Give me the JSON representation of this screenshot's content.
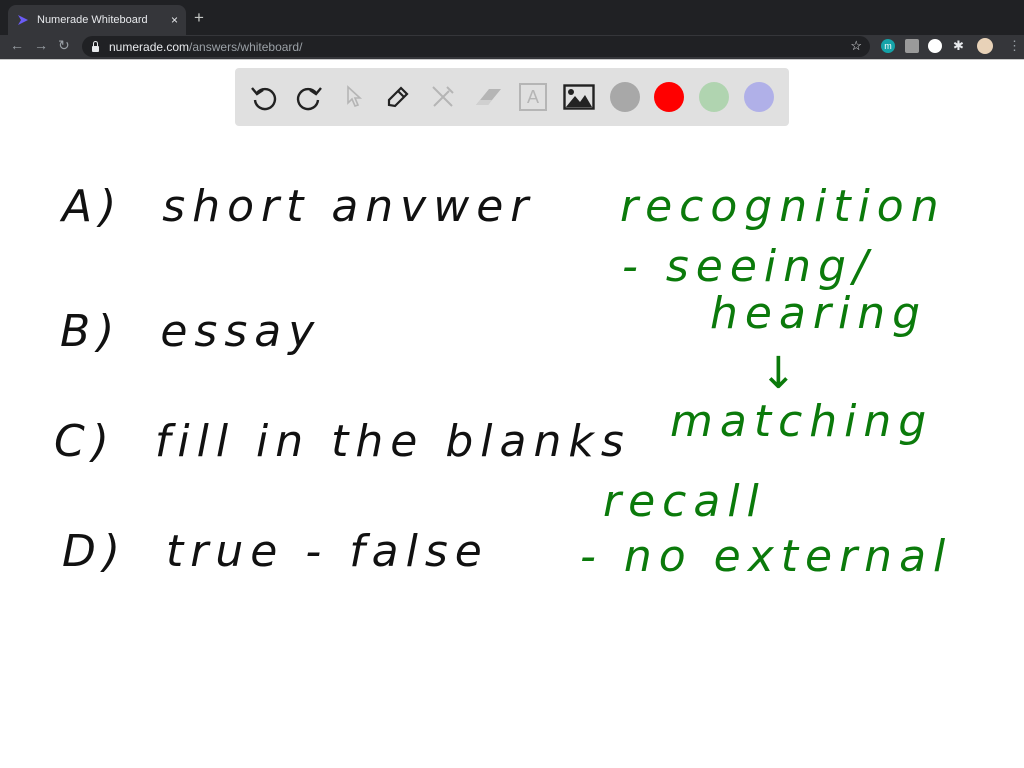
{
  "browser": {
    "tab_title": "Numerade Whiteboard",
    "tab_close": "×",
    "new_tab": "+",
    "back": "←",
    "forward": "→",
    "reload": "↻",
    "url_host": "numerade.com",
    "url_path": "/answers/whiteboard/",
    "bookmark": "☆",
    "extension_m": "m",
    "extensions_icon": "✱"
  },
  "whiteboard_toolbar": {
    "tools": [
      "undo",
      "redo",
      "select",
      "pen",
      "tools",
      "eraser",
      "text",
      "image"
    ],
    "colors": [
      "#a8a8a8",
      "#ff0000",
      "#b0d4b0",
      "#b0b0e8"
    ],
    "text_tool_glyph": "A"
  },
  "canvas": {
    "left_column": [
      {
        "label": "A)",
        "text": "short anvwer"
      },
      {
        "label": "B)",
        "text": "essay"
      },
      {
        "label": "C)",
        "text": "fill in the blanks"
      },
      {
        "label": "D)",
        "text": "true - false"
      }
    ],
    "right_column": {
      "line1": "recognition",
      "line2": "- seeing/",
      "line3": "hearing",
      "arrow": "↓",
      "line4": "matching",
      "line5": "recall",
      "line6": "- no external"
    },
    "ink_black": "#111111",
    "ink_green": "#0b7a0b"
  }
}
